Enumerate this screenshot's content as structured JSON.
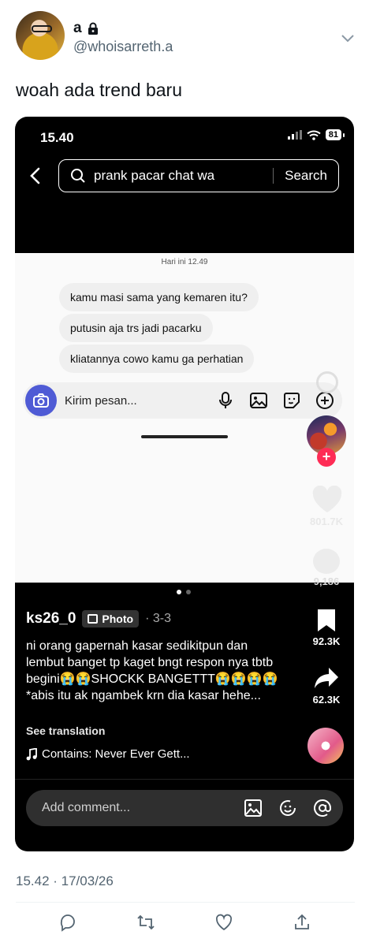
{
  "tweet": {
    "display_name": "a",
    "handle": "@whoisarreth.a",
    "text": "woah ada trend baru",
    "timestamp": "15.42 · 17/03/26"
  },
  "screenshot": {
    "status_time": "15.40",
    "battery": "81",
    "search_query": "prank pacar chat wa",
    "search_button": "Search",
    "chat": {
      "time_label": "Hari ini 12.49",
      "messages": [
        "kamu masi sama yang kemaren itu?",
        "putusin aja trs jadi pacarku",
        "kliatannya cowo kamu ga perhatian"
      ],
      "input_placeholder": "Kirim pesan..."
    },
    "likes_count": "801.7K",
    "comments_count": "9,186",
    "saves_count": "92.3K",
    "shares_count": "62.3K",
    "username": "ks26_0",
    "post_type": "Photo",
    "page_indicator": "· 3-3",
    "caption": "ni orang gapernah kasar sedikitpun dan lembut banget tp kaget bngt respon nya tbtb begini😭😭SHOCKK BANGETTT😭😭😭😭*abis itu ak ngambek krn dia kasar hehe...",
    "see_translation": "See translation",
    "music": "Contains: Never Ever Gett...",
    "comment_placeholder": "Add comment..."
  },
  "icons": {
    "lock": "lock-icon",
    "chevron": "chevron-down-icon",
    "reply": "reply-icon",
    "retweet": "retweet-icon",
    "like": "heart-icon",
    "share": "share-icon"
  },
  "colors": {
    "accent_pink": "#fe2c55",
    "dm_camera": "#4f5bd5",
    "meta_gray": "#536471"
  }
}
